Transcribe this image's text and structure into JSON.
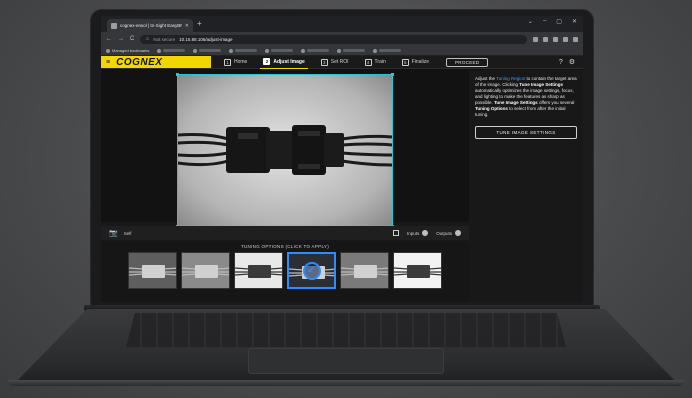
{
  "browser": {
    "tab_title": "cognex-ensol | In-Sight EasyBP",
    "new_tab": "+",
    "window_controls": [
      "⌄",
      "–",
      "▢",
      "✕"
    ],
    "nav": [
      "←",
      "→",
      "C"
    ],
    "security": "Not secure",
    "url": "10.15.88.106/adjust-image",
    "bookmarks_label": "Managed bookmarks"
  },
  "app": {
    "menu_icon": "≡",
    "brand": "COGNEX",
    "steps": [
      {
        "num": "1",
        "label": "Home"
      },
      {
        "num": "2",
        "label": "Adjust Image",
        "active": true
      },
      {
        "num": "3",
        "label": "Set ROI"
      },
      {
        "num": "4",
        "label": "Train"
      },
      {
        "num": "5",
        "label": "Finalize"
      }
    ],
    "proceed": "PROCEED",
    "help_icon": "?",
    "settings_icon": "⚙"
  },
  "viewer": {
    "trigger": "Self",
    "inputs": "Inputs",
    "outputs": "Outputs"
  },
  "side": {
    "p1": "Adjust the ",
    "p_link": "Tuning Region",
    "p2": " to contain the target area of the image. Clicking ",
    "p_b1": "Tune Image Settings",
    "p3": " automatically optimizes the image settings, focus, and lighting to make the features as sharp as possible. ",
    "p_b2": "Tune Image Settings",
    "p4": " offers you several ",
    "p_b3": "Tuning Options",
    "p5": " to select from after the initial tuning.",
    "button": "TUNE IMAGE SETTINGS"
  },
  "tuning": {
    "label": "TUNING OPTIONS (CLICK TO APPLY)",
    "thumbnails": [
      {
        "tone": "#5e5e5e"
      },
      {
        "tone": "#8a8a8a"
      },
      {
        "tone": "#e8e8e8"
      },
      {
        "tone": "#2a2f36",
        "selected": true
      },
      {
        "tone": "#7a7a7a"
      },
      {
        "tone": "#f2f2f2"
      }
    ]
  }
}
